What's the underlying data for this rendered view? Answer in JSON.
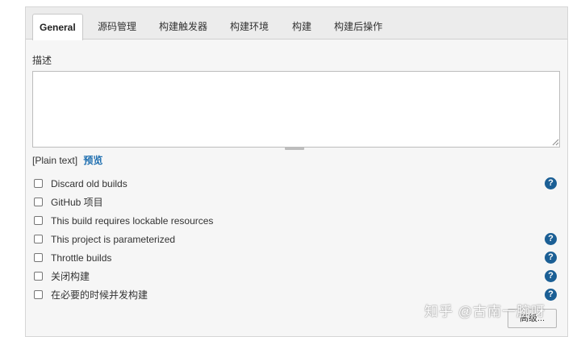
{
  "tabs": [
    {
      "label": "General",
      "active": true
    },
    {
      "label": "源码管理"
    },
    {
      "label": "构建触发器"
    },
    {
      "label": "构建环境"
    },
    {
      "label": "构建"
    },
    {
      "label": "构建后操作"
    }
  ],
  "description": {
    "label": "描述",
    "value": "",
    "format_text": "[Plain text]",
    "preview_label": "预览"
  },
  "options": [
    {
      "label": "Discard old builds",
      "checked": false,
      "help": true
    },
    {
      "label": "GitHub 项目",
      "checked": false,
      "help": false
    },
    {
      "label": "This build requires lockable resources",
      "checked": false,
      "help": false
    },
    {
      "label": "This project is parameterized",
      "checked": false,
      "help": true
    },
    {
      "label": "Throttle builds",
      "checked": false,
      "help": true
    },
    {
      "label": "关闭构建",
      "checked": false,
      "help": true
    },
    {
      "label": "在必要的时候并发构建",
      "checked": false,
      "help": true
    }
  ],
  "help_glyph": "?",
  "advanced_label": "高级...",
  "watermark": "知乎 @古南一腕呀",
  "colors": {
    "link": "#1f6fb0",
    "help_icon": "#1b5f95",
    "panel_bg": "#f6f6f6",
    "tabbar_bg": "#ececec"
  }
}
